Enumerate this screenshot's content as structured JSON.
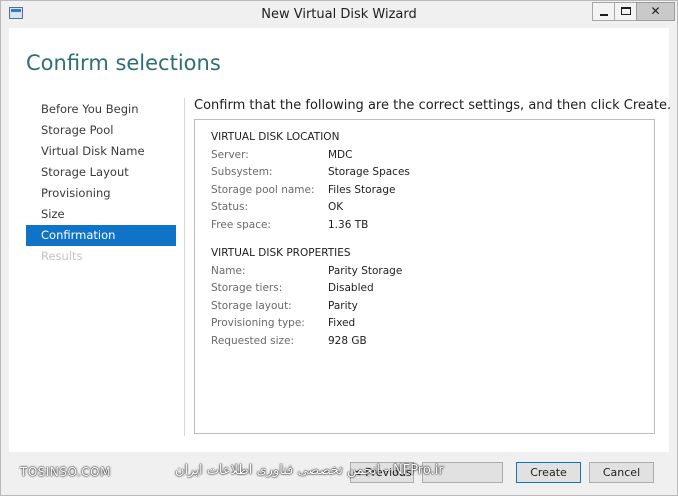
{
  "window": {
    "title": "New Virtual Disk Wizard",
    "minimize_glyph": "",
    "maximize_glyph": "",
    "close_glyph": "✕"
  },
  "page": {
    "title": "Confirm selections",
    "intro": "Confirm that the following are the correct settings, and then click Create."
  },
  "nav": {
    "items": [
      {
        "label": "Before You Begin"
      },
      {
        "label": "Storage Pool"
      },
      {
        "label": "Virtual Disk Name"
      },
      {
        "label": "Storage Layout"
      },
      {
        "label": "Provisioning"
      },
      {
        "label": "Size"
      },
      {
        "label": "Confirmation"
      },
      {
        "label": "Results"
      }
    ],
    "active": "Confirmation"
  },
  "location": {
    "heading": "VIRTUAL DISK LOCATION",
    "rows": [
      {
        "label": "Server:",
        "value": "MDC"
      },
      {
        "label": "Subsystem:",
        "value": "Storage Spaces"
      },
      {
        "label": "Storage pool name:",
        "value": "Files Storage"
      },
      {
        "label": "Status:",
        "value": "OK"
      },
      {
        "label": "Free space:",
        "value": "1.36 TB"
      }
    ]
  },
  "properties": {
    "heading": "VIRTUAL DISK PROPERTIES",
    "rows": [
      {
        "label": "Name:",
        "value": "Parity Storage"
      },
      {
        "label": "Storage tiers:",
        "value": "Disabled"
      },
      {
        "label": "Storage layout:",
        "value": "Parity"
      },
      {
        "label": "Provisioning type:",
        "value": "Fixed"
      },
      {
        "label": "Requested size:",
        "value": "928 GB"
      }
    ]
  },
  "buttons": {
    "previous": "< Previous",
    "next": "",
    "create": "Create",
    "cancel": "Cancel"
  },
  "watermark": {
    "left": "TOSINSO.COM",
    "right": "انجمن تخصصی فناوری اطلاعات ایران - NFPro.ir"
  },
  "colors": {
    "title_accent": "#2e6e77",
    "active_nav": "#0f73c7"
  },
  "icons": {
    "app": "virtual-disk-wizard-icon"
  }
}
